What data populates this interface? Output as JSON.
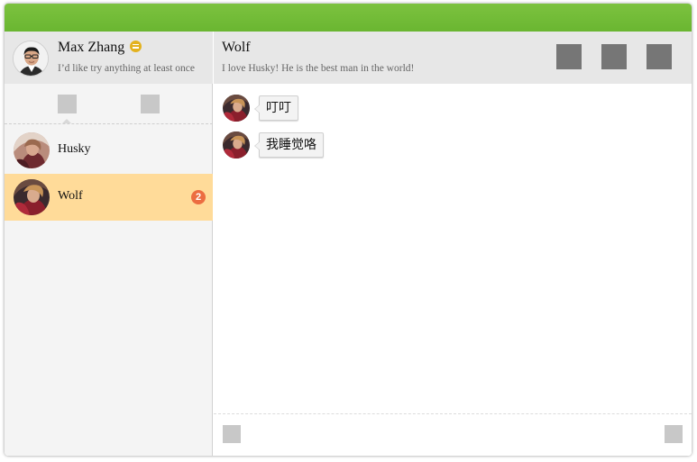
{
  "window": {
    "titlebar_color": "#6ab631",
    "accent_active": "#ffdb99",
    "badge_color": "#ec6d41"
  },
  "profile": {
    "name": "Max Zhang",
    "status_icon": "menu-status-icon",
    "motto": "I’d like try anything at least once"
  },
  "sidebar": {
    "tabs": [
      {
        "icon": "chat-tab-icon",
        "selected": true
      },
      {
        "icon": "contacts-tab-icon",
        "selected": false
      }
    ],
    "contacts": [
      {
        "name": "Husky",
        "unread": "",
        "active": false
      },
      {
        "name": "Wolf",
        "unread": "2",
        "active": true
      }
    ]
  },
  "chat": {
    "title": "Wolf",
    "subtitle": "I love Husky! He is the best man in the world!",
    "header_buttons": [
      "call-icon",
      "video-icon",
      "more-icon"
    ],
    "messages": [
      {
        "from": "Wolf",
        "text": "叮叮"
      },
      {
        "from": "Wolf",
        "text": "我睡觉咯"
      }
    ]
  },
  "composer": {
    "left_button": "emoji-icon",
    "right_button": "send-icon"
  }
}
